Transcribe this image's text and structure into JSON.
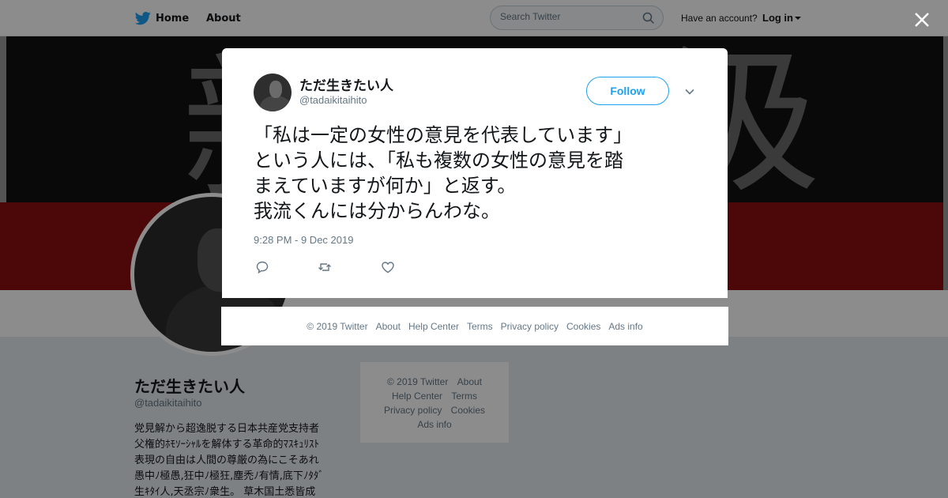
{
  "topbar": {
    "home_label": "Home",
    "about_label": "About",
    "search_placeholder": "Search Twitter",
    "account_prompt": "Have an account?",
    "login_label": "Log in"
  },
  "profile": {
    "name": "ただ生きたい人",
    "handle": "@tadaikitaihito",
    "bio_lines": [
      "党見解から超逸脱する日本共産党支持者",
      "父権的ﾎﾓｿｰｼｬﾙを解体する革命的ﾏｽｷｭﾘｽﾄ",
      "表現の自由は人間の尊厳の為にこそあれ",
      "愚中ﾉ極愚,狂中ﾉ極狂,塵禿ﾉ有情,底下ﾉﾀﾀﾞ",
      "生ｷﾀｲ人,天丞宗ﾉ衆生。 草木国土悉皆成"
    ]
  },
  "side_footer": {
    "links": [
      "© 2019 Twitter",
      "About",
      "Help Center",
      "Terms",
      "Privacy policy",
      "Cookies",
      "Ads info"
    ]
  },
  "tweet": {
    "author_name": "ただ生きたい人",
    "author_handle": "@tadaikitaihito",
    "follow_label": "Follow",
    "text_lines": [
      "「私は一定の女性の意見を代表しています」",
      "という人には、「私も複数の女性の意見を踏",
      "まえていますが何か」と返す。",
      "我流くんには分からんわな。"
    ],
    "timestamp": "9:28 PM - 9 Dec 2019"
  },
  "modal_footer": {
    "links": [
      "© 2019 Twitter",
      "About",
      "Help Center",
      "Terms",
      "Privacy policy",
      "Cookies",
      "Ads info"
    ]
  },
  "colors": {
    "brand_blue": "#1da1f2",
    "text_primary": "#14171a",
    "text_secondary": "#657786",
    "banner_red": "#8a1010"
  },
  "icons": {
    "logo": "twitter-bird-icon",
    "search": "search-icon",
    "close": "close-icon",
    "more": "chevron-down-icon",
    "reply": "reply-icon",
    "retweet": "retweet-icon",
    "like": "heart-icon"
  }
}
